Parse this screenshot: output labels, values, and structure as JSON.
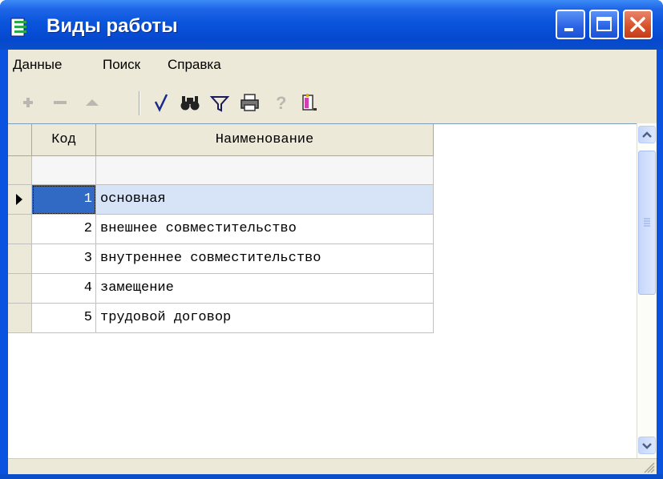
{
  "window": {
    "title": "Виды работы"
  },
  "menu": {
    "items": [
      "Данные",
      "Поиск",
      "Справка"
    ]
  },
  "toolbar": {
    "icons": [
      "add-icon",
      "delete-icon",
      "up-icon",
      "checkmark-icon",
      "find-icon",
      "filter-icon",
      "print-icon",
      "help-icon",
      "exit-icon"
    ]
  },
  "table": {
    "columns": [
      "Код",
      "Наименование"
    ],
    "rows": [
      {
        "code": "1",
        "name": "основная",
        "selected": true
      },
      {
        "code": "2",
        "name": "внешнее совместительство"
      },
      {
        "code": "3",
        "name": "внутреннее совместительство"
      },
      {
        "code": "4",
        "name": "замещение"
      },
      {
        "code": "5",
        "name": "трудовой договор"
      }
    ]
  },
  "colors": {
    "title_bar": "#0a55dc",
    "selected_row": "#d7e4f8",
    "client_bg": "#ece9d8"
  }
}
